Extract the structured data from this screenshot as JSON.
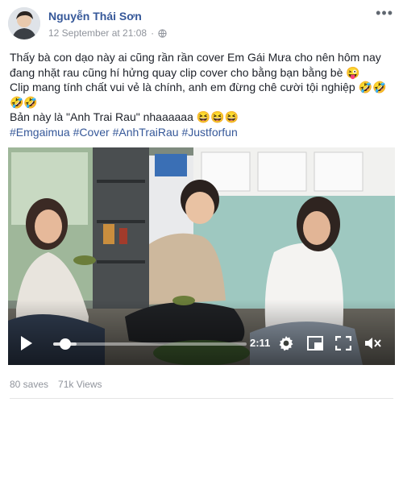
{
  "post": {
    "author": "Nguyễn Thái Sơn",
    "timestamp": "12 September at 21:08",
    "privacy_icon": "globe-icon",
    "more_icon": "more-dots-icon",
    "text_line1": "Thấy bà con dạo này ai cũng rần rần cover Em Gái Mưa cho nên hôm nay đang nhặt rau cũng hí hửng quay clip cover cho bằng bạn bằng bè 😜",
    "text_line2": "Clip mang tính chất vui vẻ là chính, anh em đừng chê cười tội nghiệp 🤣🤣🤣🤣",
    "text_line3": "Bản này là \"Anh Trai Rau\" nhaaaaaa 😆😆😆",
    "hashtags": "#Emgaimua #Cover #AnhTraiRau #Justforfun"
  },
  "video": {
    "time_remaining": "2:11",
    "progress": 0.04,
    "buffered": 0.12
  },
  "stats": {
    "saves": "80 saves",
    "views": "71k Views"
  }
}
